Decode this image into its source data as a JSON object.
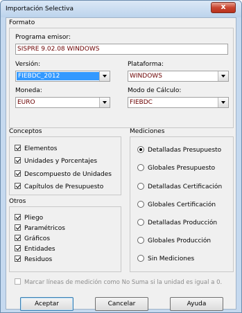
{
  "window": {
    "title": "Importación Selectiva",
    "close_glyph": "x"
  },
  "formato": {
    "legend": "Formato",
    "programa_label": "Programa emisor:",
    "programa_value": "SISPRE 9.02.08 WINDOWS",
    "version_label": "Versión:",
    "version_value": "FIEBDC_2012",
    "plataforma_label": "Plataforma:",
    "plataforma_value": "WINDOWS",
    "moneda_label": "Moneda:",
    "moneda_value": "EURO",
    "modo_label": "Modo de Cálculo:",
    "modo_value": "FIEBDC"
  },
  "conceptos": {
    "legend": "Conceptos",
    "items": [
      {
        "label": "Elementos",
        "checked": true
      },
      {
        "label": "Unidades y Porcentajes",
        "checked": true
      },
      {
        "label": "Descompuesto de Unidades",
        "checked": true
      },
      {
        "label": "Capítulos de Presupuesto",
        "checked": true
      }
    ]
  },
  "otros": {
    "legend": "Otros",
    "items": [
      {
        "label": "Pliego",
        "checked": true
      },
      {
        "label": "Paramétricos",
        "checked": true
      },
      {
        "label": "Gráficos",
        "checked": true
      },
      {
        "label": "Entidades",
        "checked": true
      },
      {
        "label": "Residuos",
        "checked": true
      }
    ]
  },
  "mediciones": {
    "legend": "Mediciones",
    "options": [
      {
        "label": "Detalladas Presupuesto",
        "selected": true
      },
      {
        "label": "Globales Presupuesto",
        "selected": false
      },
      {
        "label": "Detalladas Certificación",
        "selected": false
      },
      {
        "label": "Globales Certificación",
        "selected": false
      },
      {
        "label": "Detalladas Producción",
        "selected": false
      },
      {
        "label": "Globales Producción",
        "selected": false
      },
      {
        "label": "Sin Mediciones",
        "selected": false
      }
    ]
  },
  "marcar": {
    "label": "Marcar líneas de medición como No Suma si la unidad es igual a 0.",
    "checked": false,
    "enabled": false
  },
  "buttons": {
    "accept": "Aceptar",
    "cancel": "Cancelar",
    "help": "Ayuda"
  },
  "colors": {
    "selection": "#3399ff",
    "field_text": "#6b0000",
    "accent_text": "#1a1a9a"
  }
}
